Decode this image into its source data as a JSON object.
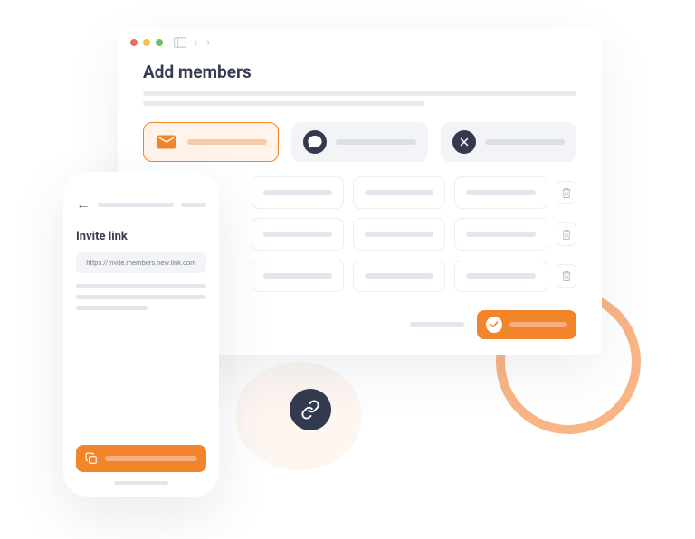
{
  "browser": {
    "title": "Add members",
    "methods": [
      {
        "type": "email",
        "active": true
      },
      {
        "type": "chat",
        "active": false
      },
      {
        "type": "close",
        "active": false
      }
    ],
    "rows": 3,
    "cols": 3,
    "confirm_label": "",
    "cancel_label": ""
  },
  "phone": {
    "title": "Invite link",
    "url": "https://invite.members.new.link.com",
    "copy_label": ""
  },
  "accent": "#f28429"
}
